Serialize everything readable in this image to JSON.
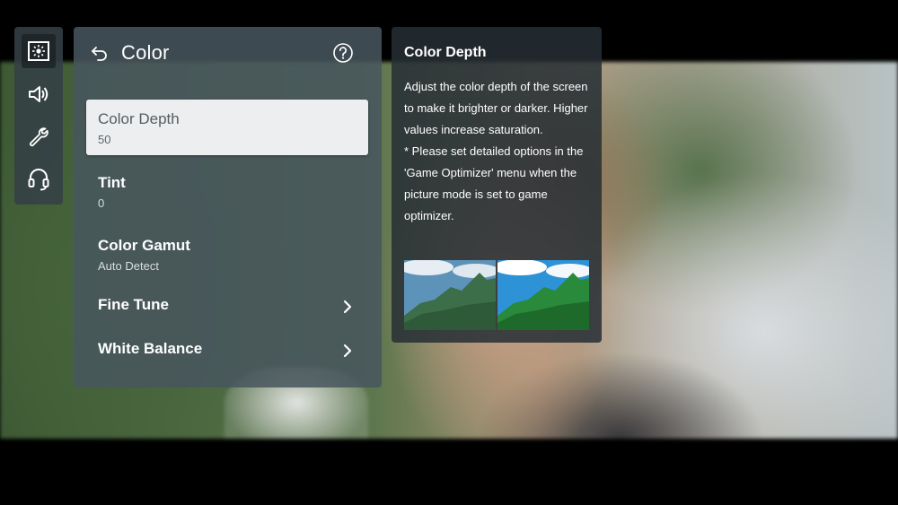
{
  "sidebar": {
    "icons": [
      {
        "name": "picture-icon",
        "active": true
      },
      {
        "name": "sound-icon",
        "active": false
      },
      {
        "name": "general-wrench-icon",
        "active": false
      },
      {
        "name": "support-headset-icon",
        "active": false
      }
    ]
  },
  "menu": {
    "title": "Color",
    "items": [
      {
        "label": "Color Depth",
        "value": "50",
        "selected": true
      },
      {
        "label": "Tint",
        "value": "0"
      },
      {
        "label": "Color Gamut",
        "value": "Auto Detect"
      },
      {
        "label": "Fine Tune",
        "value": "",
        "has_submenu": true
      },
      {
        "label": "White Balance",
        "value": "",
        "has_submenu": true
      }
    ]
  },
  "help": {
    "title": "Color Depth",
    "description": "Adjust the color depth of the screen to make it brighter or darker. Higher values increase saturation.",
    "note": "* Please set detailed options in the 'Game Optimizer' menu when the picture mode is set to game optimizer."
  },
  "colors": {
    "panel": "#48565e",
    "selected_item": "#eceef0",
    "help_panel": "#262e34"
  }
}
